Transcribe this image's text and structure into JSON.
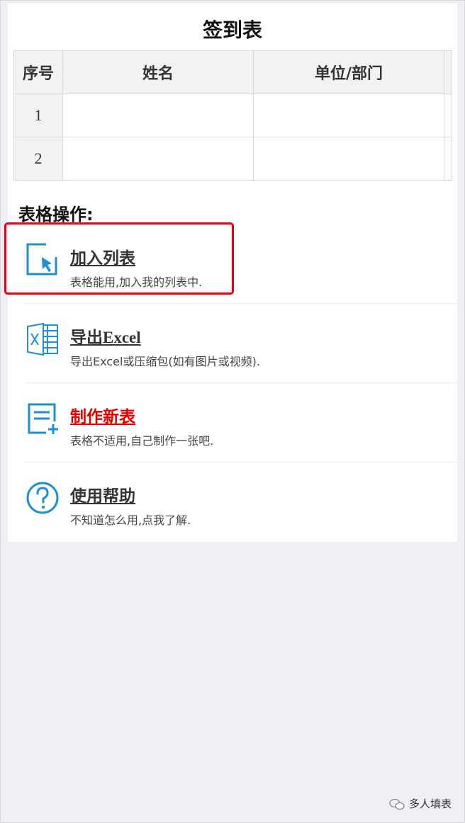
{
  "page_title": "签到表",
  "table": {
    "headers": [
      "序号",
      "姓名",
      "单位/部门"
    ],
    "rows": [
      {
        "num": "1",
        "name": "",
        "dept": ""
      },
      {
        "num": "2",
        "name": "",
        "dept": ""
      }
    ]
  },
  "section_title": "表格操作:",
  "actions": [
    {
      "icon": "add-to-list-icon",
      "label": "加入列表",
      "desc": "表格能用,加入我的列表中."
    },
    {
      "icon": "excel-icon",
      "label": "导出Excel",
      "desc": "导出Excel或压缩包(如有图片或视频)."
    },
    {
      "icon": "new-form-icon",
      "label": "制作新表",
      "desc": "表格不适用,自己制作一张吧."
    },
    {
      "icon": "help-icon",
      "label": "使用帮助",
      "desc": "不知道怎么用,点我了解."
    }
  ],
  "watermark": "多人填表",
  "colors": {
    "accent": "#1e8fd5",
    "highlight": "#e60012",
    "link_red": "#e30000",
    "background": "#f0eff4"
  }
}
